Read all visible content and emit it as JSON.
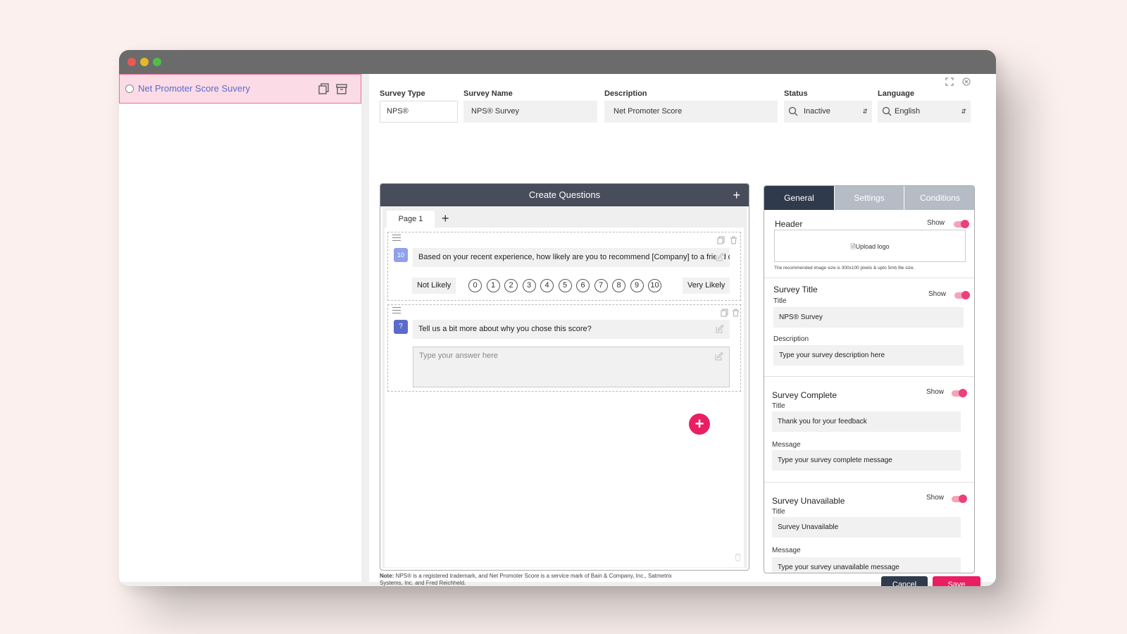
{
  "window": {
    "controls": [
      "close",
      "minimize",
      "maximize"
    ]
  },
  "sidebar": {
    "survey_name": "Net Promoter Score Suvery"
  },
  "form": {
    "survey_type_label": "Survey Type",
    "survey_type_value": "NPS®",
    "survey_name_label": "Survey Name",
    "survey_name_value": "NPS®  Survey",
    "description_label": "Description",
    "description_value": "Net Promoter Score",
    "status_label": "Status",
    "status_value": "Inactive",
    "language_label": "Language",
    "language_value": "English"
  },
  "questions_panel": {
    "title": "Create Questions",
    "page_tab": "Page 1",
    "q1": {
      "number": "10",
      "text": "Based on your recent experience, how likely are you to recommend [Company] to a friend or colleague?",
      "low_label": "Not Likely",
      "high_label": "Very Likely",
      "scale": [
        "0",
        "1",
        "2",
        "3",
        "4",
        "5",
        "6",
        "7",
        "8",
        "9",
        "10"
      ]
    },
    "q2": {
      "icon": "question-icon",
      "text": "Tell us a bit more about why you chose this score?",
      "placeholder": "Type your answer here"
    }
  },
  "note": {
    "prefix": "Note:",
    "text": " NPS® is a registered trademark, and Net Promoter Score is a service mark of  Bain & Company, Inc., Satmetrix Systems, Inc. and Fred Reichheld."
  },
  "settings_panel": {
    "tabs": [
      "General",
      "Settings",
      "Conditions"
    ],
    "active_tab": "General",
    "show_label": "Show",
    "header": {
      "title": "Header",
      "upload": "Upload logo",
      "hint": "The recommended image size is 300x100 pixels & upto 5mb file size."
    },
    "survey_title": {
      "title": "Survey Title",
      "title_label": "Title",
      "title_value": "NPS®  Survey",
      "desc_label": "Description",
      "desc_value": "Type your survey description here"
    },
    "survey_complete": {
      "title": "Survey Complete",
      "title_label": "Title",
      "title_value": "Thank you for your feedback",
      "message_label": "Message",
      "message_value": "Type your survey complete message"
    },
    "survey_unavailable": {
      "title": "Survey Unavailable",
      "title_label": "Title",
      "title_value": "Survey Unavailable",
      "message_label": "Message",
      "message_value": "Type your survey unavailable message"
    }
  },
  "buttons": {
    "cancel": "Cancel",
    "save": "Save"
  },
  "colors": {
    "accent": "#e91e63",
    "dark": "#2f3b4c",
    "link": "#5b6acb"
  }
}
